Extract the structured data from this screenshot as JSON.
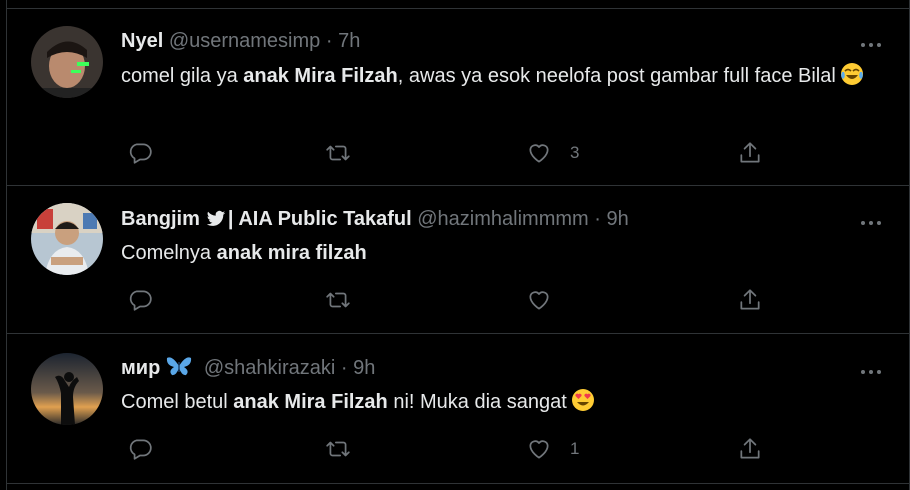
{
  "tweets": [
    {
      "name": "Nyel",
      "handle": "@usernamesimp",
      "separator": "·",
      "time": "7h",
      "text_before": "comel gila ya ",
      "text_bold": "anak Mira Filzah",
      "text_after": ", awas ya esok neelofa post gambar full face Bilal",
      "emoji": "face-with-tears-of-joy",
      "like_count": "3",
      "verified": false
    },
    {
      "name": "Bangjim",
      "name_suffix": "| AIA Public Takaful",
      "handle": "@hazimhalimmmm",
      "separator": "·",
      "time": "9h",
      "text_before": "Comelnya ",
      "text_bold": "anak mira filzah",
      "text_after": "",
      "like_count": "",
      "verified": true
    },
    {
      "name": "мир",
      "name_emoji": "butterfly",
      "handle": "@shahkirazaki",
      "separator": "·",
      "time": "9h",
      "text_before": "Comel betul ",
      "text_bold": "anak Mira Filzah",
      "text_after": " ni! Muka dia sangat",
      "emoji": "smiling-face-with-heart-eyes",
      "like_count": "1",
      "verified": false
    }
  ],
  "colors": {
    "background": "#000000",
    "text": "#e7e9ea",
    "secondary": "#71767b",
    "border": "#2f3336",
    "verified_blue": "#1d9bf0"
  }
}
